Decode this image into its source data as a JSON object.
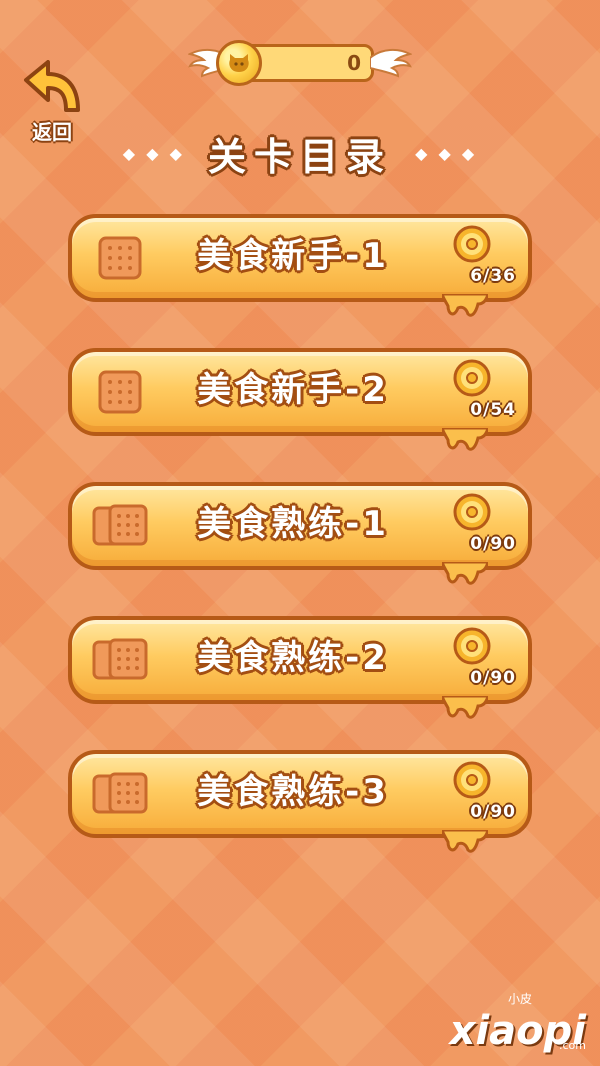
{
  "header": {
    "coin_count": "0",
    "back_label": "返回",
    "title": "关卡目录",
    "title_decoration": "◆ ◆ ◆"
  },
  "levels": [
    {
      "name": "美食新手-1",
      "progress": "6/36",
      "icon": "single-cracker-icon"
    },
    {
      "name": "美食新手-2",
      "progress": "0/54",
      "icon": "single-cracker-icon"
    },
    {
      "name": "美食熟练-1",
      "progress": "0/90",
      "icon": "double-cracker-icon"
    },
    {
      "name": "美食熟练-2",
      "progress": "0/90",
      "icon": "double-cracker-icon"
    },
    {
      "name": "美食熟练-3",
      "progress": "0/90",
      "icon": "double-cracker-icon"
    }
  ],
  "watermark": {
    "text": "xiaopi",
    "small": "小皮",
    "domain": ".com"
  },
  "colors": {
    "background": "#f19a62",
    "card_fill": "#ffcb60",
    "card_border": "#b65a17",
    "outline_text": "#8c4312"
  }
}
